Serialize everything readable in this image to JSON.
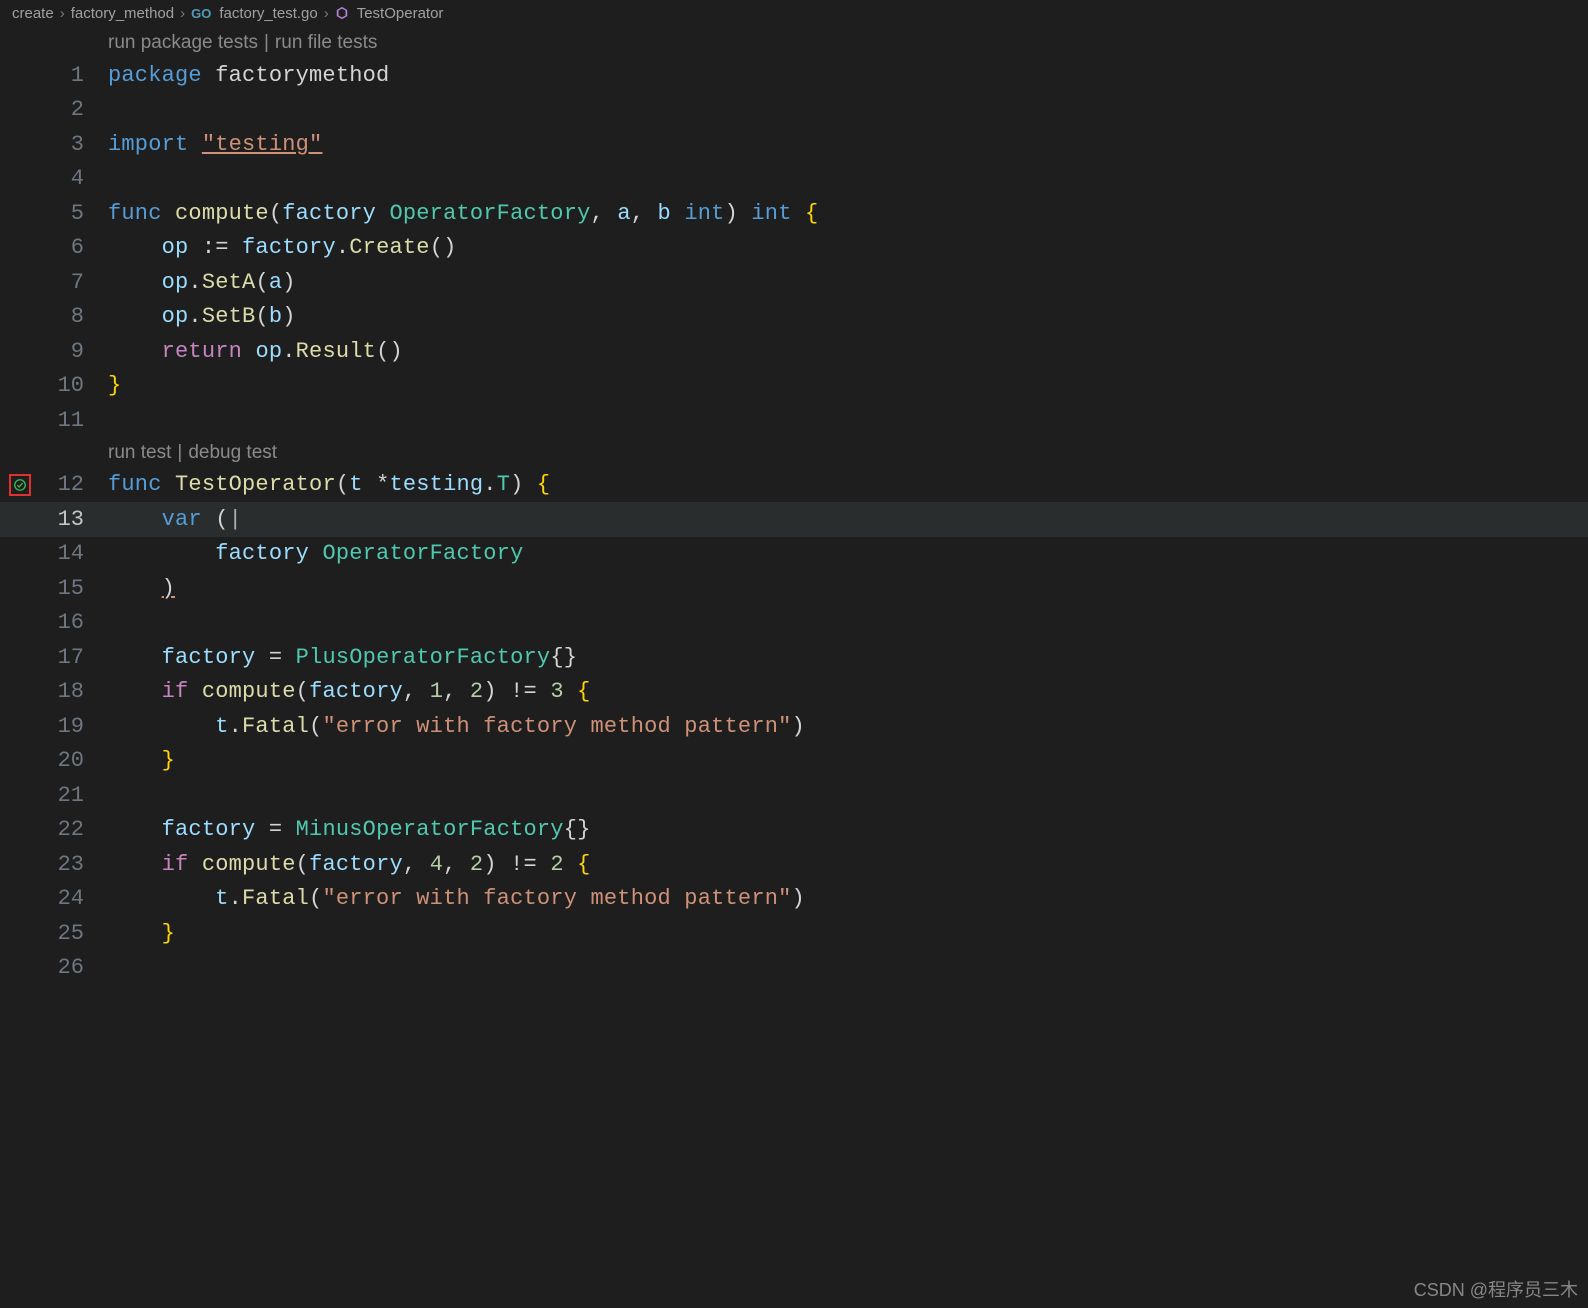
{
  "breadcrumbs": {
    "items": [
      "create",
      "factory_method",
      "factory_test.go",
      "TestOperator"
    ],
    "fileIconLabel": "go-file-icon",
    "symbolIconLabel": "symbol-method-icon"
  },
  "codelens": {
    "pkg": {
      "run": "run package tests",
      "file": "run file tests"
    },
    "test": {
      "run": "run test",
      "debug": "debug test"
    }
  },
  "gutter": {
    "testStatusIcon": "test-pass-icon",
    "highlightBoxColor": "#e03030"
  },
  "activeLine": 13,
  "testIconLine": 12,
  "lines": [
    {
      "n": 1,
      "tokens": [
        [
          "kw",
          "package "
        ],
        [
          "ident",
          "factorymethod"
        ]
      ]
    },
    {
      "n": 2,
      "tokens": []
    },
    {
      "n": 3,
      "tokens": [
        [
          "kw",
          "import "
        ],
        [
          "str underline",
          "\"testing\""
        ]
      ]
    },
    {
      "n": 4,
      "tokens": []
    },
    {
      "n": 5,
      "tokens": [
        [
          "kw",
          "func "
        ],
        [
          "fn",
          "compute"
        ],
        [
          "punc",
          "("
        ],
        [
          "var",
          "factory "
        ],
        [
          "type",
          "OperatorFactory"
        ],
        [
          "punc",
          ", "
        ],
        [
          "var",
          "a"
        ],
        [
          "punc",
          ", "
        ],
        [
          "var",
          "b "
        ],
        [
          "kw",
          "int"
        ],
        [
          "punc",
          ") "
        ],
        [
          "kw",
          "int"
        ],
        [
          "punc",
          " "
        ],
        [
          "brace",
          "{"
        ]
      ]
    },
    {
      "n": 6,
      "tokens": [
        [
          "ident",
          "    "
        ],
        [
          "var",
          "op"
        ],
        [
          "op",
          " := "
        ],
        [
          "var",
          "factory"
        ],
        [
          "punc",
          "."
        ],
        [
          "fn",
          "Create"
        ],
        [
          "punc",
          "()"
        ]
      ]
    },
    {
      "n": 7,
      "tokens": [
        [
          "ident",
          "    "
        ],
        [
          "var",
          "op"
        ],
        [
          "punc",
          "."
        ],
        [
          "fn",
          "SetA"
        ],
        [
          "punc",
          "("
        ],
        [
          "var",
          "a"
        ],
        [
          "punc",
          ")"
        ]
      ]
    },
    {
      "n": 8,
      "tokens": [
        [
          "ident",
          "    "
        ],
        [
          "var",
          "op"
        ],
        [
          "punc",
          "."
        ],
        [
          "fn",
          "SetB"
        ],
        [
          "punc",
          "("
        ],
        [
          "var",
          "b"
        ],
        [
          "punc",
          ")"
        ]
      ]
    },
    {
      "n": 9,
      "tokens": [
        [
          "ident",
          "    "
        ],
        [
          "kw2",
          "return "
        ],
        [
          "var",
          "op"
        ],
        [
          "punc",
          "."
        ],
        [
          "fn",
          "Result"
        ],
        [
          "punc",
          "()"
        ]
      ]
    },
    {
      "n": 10,
      "tokens": [
        [
          "brace",
          "}"
        ]
      ]
    },
    {
      "n": 11,
      "tokens": []
    },
    {
      "n": 12,
      "tokens": [
        [
          "kw",
          "func "
        ],
        [
          "fn",
          "TestOperator"
        ],
        [
          "punc",
          "("
        ],
        [
          "var",
          "t "
        ],
        [
          "op",
          "*"
        ],
        [
          "var",
          "testing"
        ],
        [
          "punc",
          "."
        ],
        [
          "type",
          "T"
        ],
        [
          "punc",
          ") "
        ],
        [
          "brace",
          "{"
        ]
      ]
    },
    {
      "n": 13,
      "tokens": [
        [
          "ident",
          "    "
        ],
        [
          "kw",
          "var"
        ],
        [
          "punc",
          " ("
        ],
        [
          "cursor-pipe",
          "|"
        ]
      ]
    },
    {
      "n": 14,
      "tokens": [
        [
          "ident",
          "        "
        ],
        [
          "var",
          "factory "
        ],
        [
          "type",
          "OperatorFactory"
        ]
      ]
    },
    {
      "n": 15,
      "tokens": [
        [
          "ident",
          "    "
        ],
        [
          "punc underline",
          ")"
        ]
      ]
    },
    {
      "n": 16,
      "tokens": []
    },
    {
      "n": 17,
      "tokens": [
        [
          "ident",
          "    "
        ],
        [
          "var",
          "factory"
        ],
        [
          "op",
          " = "
        ],
        [
          "type",
          "PlusOperatorFactory"
        ],
        [
          "punc",
          "{}"
        ]
      ]
    },
    {
      "n": 18,
      "tokens": [
        [
          "ident",
          "    "
        ],
        [
          "kw2",
          "if "
        ],
        [
          "fn",
          "compute"
        ],
        [
          "punc",
          "("
        ],
        [
          "var",
          "factory"
        ],
        [
          "punc",
          ", "
        ],
        [
          "num",
          "1"
        ],
        [
          "punc",
          ", "
        ],
        [
          "num",
          "2"
        ],
        [
          "punc",
          ") "
        ],
        [
          "op",
          "!= "
        ],
        [
          "num",
          "3"
        ],
        [
          "punc",
          " "
        ],
        [
          "brace",
          "{"
        ]
      ]
    },
    {
      "n": 19,
      "tokens": [
        [
          "ident",
          "        "
        ],
        [
          "var",
          "t"
        ],
        [
          "punc",
          "."
        ],
        [
          "fn",
          "Fatal"
        ],
        [
          "punc",
          "("
        ],
        [
          "str",
          "\"error with factory method pattern\""
        ],
        [
          "punc",
          ")"
        ]
      ]
    },
    {
      "n": 20,
      "tokens": [
        [
          "ident",
          "    "
        ],
        [
          "brace",
          "}"
        ]
      ]
    },
    {
      "n": 21,
      "tokens": []
    },
    {
      "n": 22,
      "tokens": [
        [
          "ident",
          "    "
        ],
        [
          "var",
          "factory"
        ],
        [
          "op",
          " = "
        ],
        [
          "type",
          "MinusOperatorFactory"
        ],
        [
          "punc",
          "{}"
        ]
      ]
    },
    {
      "n": 23,
      "tokens": [
        [
          "ident",
          "    "
        ],
        [
          "kw2",
          "if "
        ],
        [
          "fn",
          "compute"
        ],
        [
          "punc",
          "("
        ],
        [
          "var",
          "factory"
        ],
        [
          "punc",
          ", "
        ],
        [
          "num",
          "4"
        ],
        [
          "punc",
          ", "
        ],
        [
          "num",
          "2"
        ],
        [
          "punc",
          ") "
        ],
        [
          "op",
          "!= "
        ],
        [
          "num",
          "2"
        ],
        [
          "punc",
          " "
        ],
        [
          "brace",
          "{"
        ]
      ]
    },
    {
      "n": 24,
      "tokens": [
        [
          "ident",
          "        "
        ],
        [
          "var",
          "t"
        ],
        [
          "punc",
          "."
        ],
        [
          "fn",
          "Fatal"
        ],
        [
          "punc",
          "("
        ],
        [
          "str",
          "\"error with factory method pattern\""
        ],
        [
          "punc",
          ")"
        ]
      ]
    },
    {
      "n": 25,
      "tokens": [
        [
          "ident",
          "    "
        ],
        [
          "brace",
          "}"
        ]
      ]
    },
    {
      "n": 26,
      "tokens": [
        [
          "ident",
          "    "
        ],
        [
          "brace",
          ""
        ]
      ]
    }
  ],
  "watermark": "CSDN @程序员三木"
}
